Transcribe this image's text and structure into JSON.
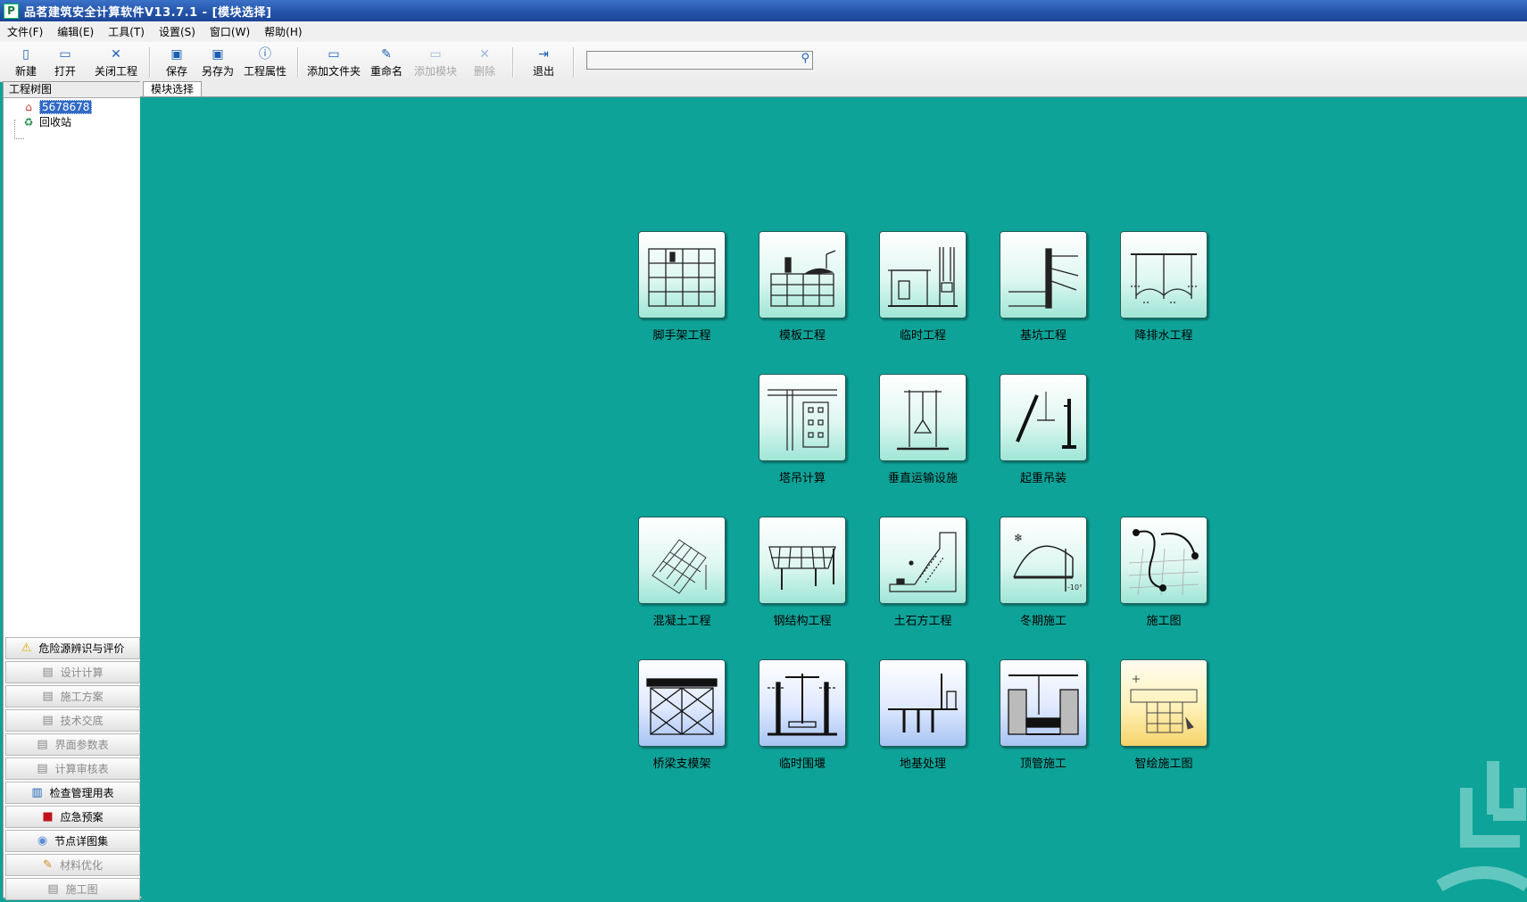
{
  "window": {
    "title": "品茗建筑安全计算软件V13.7.1 - [模块选择]",
    "app_icon": "P"
  },
  "menu": [
    "文件(F)",
    "编辑(E)",
    "工具(T)",
    "设置(S)",
    "窗口(W)",
    "帮助(H)"
  ],
  "toolbar": {
    "new": "新建",
    "open": "打开",
    "close_project": "关闭工程",
    "save": "保存",
    "save_as": "另存为",
    "properties": "工程属性",
    "add_folder": "添加文件夹",
    "rename": "重命名",
    "add_module": "添加模块",
    "delete": "删除",
    "exit": "退出"
  },
  "search": {
    "placeholder": ""
  },
  "tree": {
    "header": "工程树图",
    "root": "5678678",
    "recycle": "回收站"
  },
  "accordion": {
    "hazard": "危险源辨识与评价",
    "design_calc": "设计计算",
    "construction_plan": "施工方案",
    "tech_disclosure": "技术交底",
    "param_table": "界面参数表",
    "calc_review": "计算审核表",
    "inspection": "检查管理用表",
    "emergency": "应急预案",
    "node_drawings": "节点详图集",
    "material_opt": "材料优化",
    "construction_drawing": "施工图"
  },
  "tab": {
    "label": "模块选择"
  },
  "modules": {
    "scaffold": "脚手架工程",
    "formwork": "模板工程",
    "temporary": "临时工程",
    "pit": "基坑工程",
    "dewatering": "降排水工程",
    "tower_crane": "塔吊计算",
    "vertical_transport": "垂直运输设施",
    "hoisting": "起重吊装",
    "concrete": "混凝土工程",
    "steel": "钢结构工程",
    "earthwork": "土石方工程",
    "winter": "冬期施工",
    "drawing": "施工图",
    "bridge_support": "桥梁支模架",
    "cofferdam": "临时围堰",
    "foundation": "地基处理",
    "pipe_jacking": "顶管施工",
    "smart_drawing": "智绘施工图"
  },
  "icons": {
    "accent": "#0ea398",
    "title_blue": "#2453a8"
  }
}
